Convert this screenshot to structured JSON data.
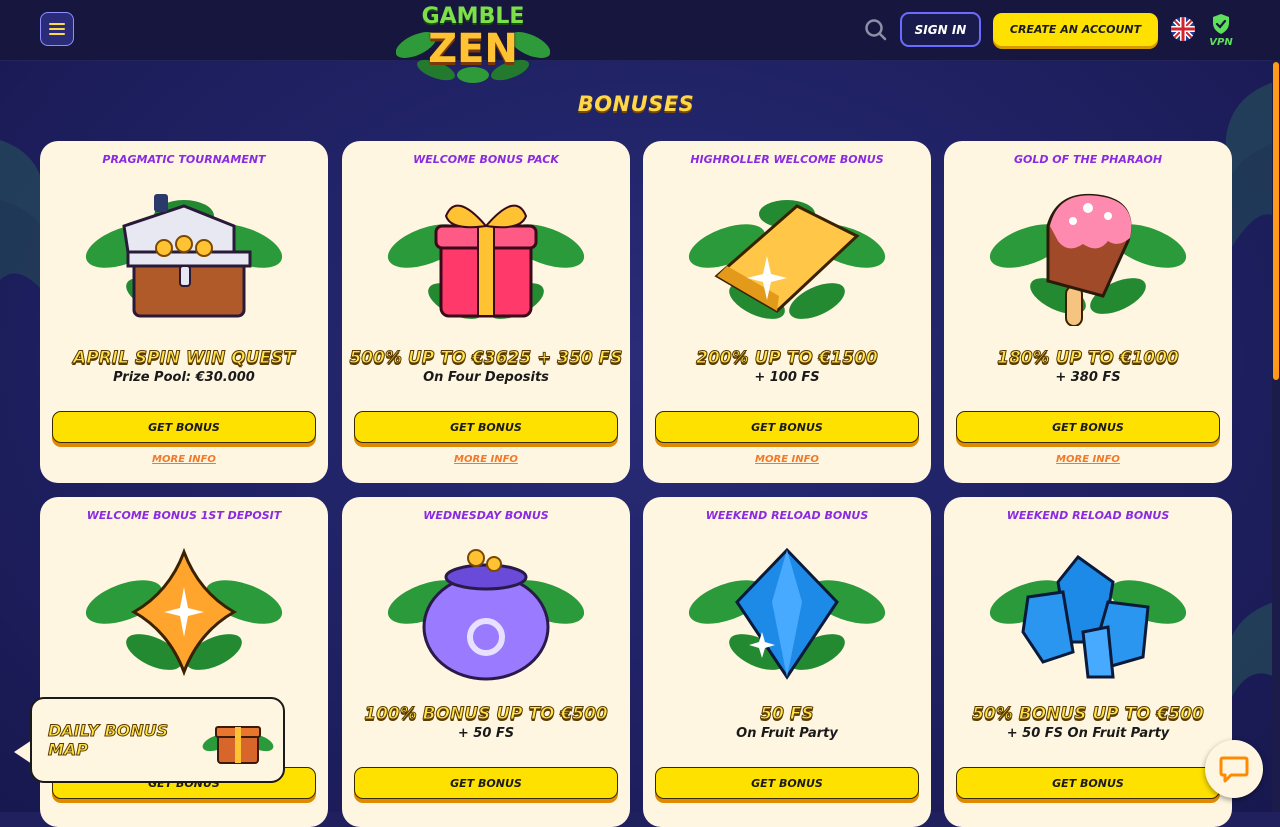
{
  "header": {
    "logo_top": "GAMBLE",
    "logo_bottom": "ZEN",
    "signin_label": "SIGN IN",
    "create_label": "CREATE AN ACCOUNT",
    "vpn_label": "VPN"
  },
  "page_title": "BONUSES",
  "cards": [
    {
      "title": "PRAGMATIC TOURNAMENT",
      "offer": "APRIL SPIN WIN QUEST",
      "sub": "Prize Pool: €30.000",
      "button": "GET BONUS",
      "more": "MORE INFO",
      "art": "treasure-chest-icon"
    },
    {
      "title": "WELCOME BONUS PACK",
      "offer": "500% UP TO €3625 + 350 FS",
      "sub": "On Four Deposits",
      "button": "GET BONUS",
      "more": "MORE INFO",
      "art": "gift-box-icon"
    },
    {
      "title": "HIGHROLLER WELCOME BONUS",
      "offer": "200% UP TO €1500",
      "sub": "+ 100 FS",
      "button": "GET BONUS",
      "more": "MORE INFO",
      "art": "gold-bar-icon"
    },
    {
      "title": "GOLD OF THE PHARAOH",
      "offer": "180% UP TO €1000",
      "sub": "+ 380 FS",
      "button": "GET BONUS",
      "more": "MORE INFO",
      "art": "ice-cream-icon"
    },
    {
      "title": "WELCOME BONUS 1ST DEPOSIT",
      "offer": "",
      "sub": "",
      "button": "GET BONUS",
      "more": "",
      "art": "orange-gem-icon"
    },
    {
      "title": "WEDNESDAY BONUS",
      "offer": "100% BONUS UP TO €500",
      "sub": "+ 50 FS",
      "button": "GET BONUS",
      "more": "",
      "art": "purple-pot-icon"
    },
    {
      "title": "WEEKEND RELOAD BONUS",
      "offer": "50 FS",
      "sub": "On Fruit Party",
      "button": "GET BONUS",
      "more": "",
      "art": "blue-diamond-icon"
    },
    {
      "title": "WEEKEND RELOAD BONUS",
      "offer": "50% BONUS UP TO €500",
      "sub": "+ 50 FS On Fruit Party",
      "button": "GET BONUS",
      "more": "",
      "art": "blue-crystals-icon"
    }
  ],
  "daily_bonus": {
    "label_line1": "DAILY BONUS",
    "label_line2": "MAP"
  },
  "colors": {
    "accent_yellow": "#ffe100",
    "title_purple": "#8a2be2",
    "link_orange": "#f07a2a",
    "card_bg": "#fff6e2"
  }
}
